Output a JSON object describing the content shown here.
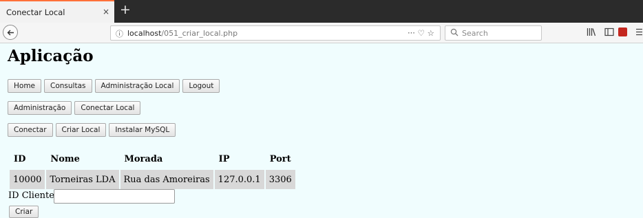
{
  "browser": {
    "tab_title": "Conectar Local",
    "tab_close": "×",
    "new_tab": "+",
    "url_host": "localhost",
    "url_path": "/051_criar_local.php",
    "url_actions": "···  ♡  ☆",
    "search_placeholder": "Search"
  },
  "page": {
    "title": "Aplicação",
    "nav_row1": [
      "Home",
      "Consultas",
      "Administração Local",
      "Logout"
    ],
    "nav_row2": [
      "Administração",
      "Conectar Local"
    ],
    "nav_row3": [
      "Conectar",
      "Criar Local",
      "Instalar MySQL"
    ]
  },
  "table": {
    "headers": [
      "ID",
      "Nome",
      "Morada",
      "IP",
      "Port"
    ],
    "rows": [
      [
        "10000",
        "Torneiras LDA",
        "Rua das Amoreiras",
        "127.0.0.1",
        "3306"
      ]
    ]
  },
  "form": {
    "label": "ID Cliente:",
    "value": "",
    "submit_label": "Criar"
  }
}
